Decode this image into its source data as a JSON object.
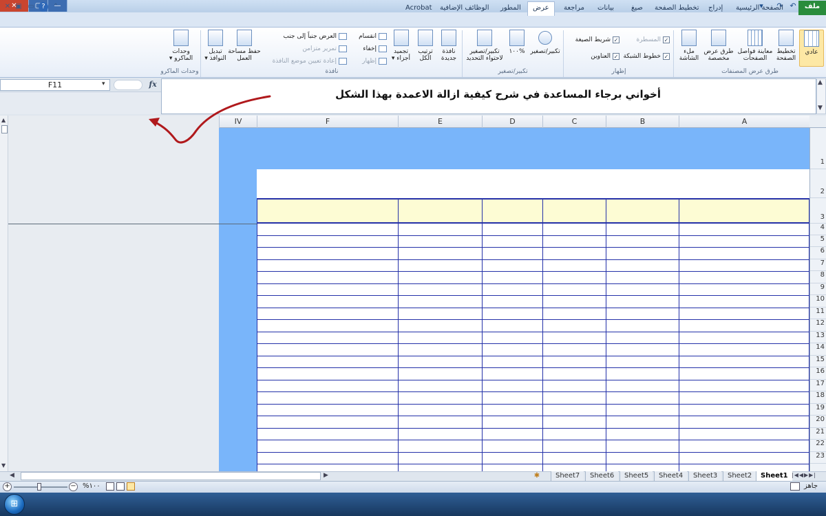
{
  "window": {
    "close": "✕",
    "restore": "▢",
    "minimize": "—",
    "qat_icons": [
      "excel-logo",
      "save-icon",
      "undo-icon",
      "redo-icon",
      "customize-icon"
    ]
  },
  "tabs": [
    {
      "label": "ملف",
      "active": false,
      "file": true
    },
    {
      "label": "الصفحة الرئيسية",
      "active": false
    },
    {
      "label": "إدراج",
      "active": false
    },
    {
      "label": "تخطيط الصفحة",
      "active": false
    },
    {
      "label": "صيغ",
      "active": false
    },
    {
      "label": "بيانات",
      "active": false
    },
    {
      "label": "مراجعة",
      "active": false
    },
    {
      "label": "عرض",
      "active": true
    },
    {
      "label": "المطور",
      "active": false
    },
    {
      "label": "الوظائف الإضافية",
      "active": false
    },
    {
      "label": "Acrobat",
      "active": false
    }
  ],
  "ribbon": {
    "workbook_views": {
      "label": "طرق عرض المصنفات",
      "buttons": [
        "عادي",
        "تخطيط\nالصفحة",
        "معاينة فواصل\nالصفحات",
        "طرق عرض\nمخصصة",
        "ملء\nالشاشة"
      ]
    },
    "show": {
      "label": "إظهار",
      "checks": [
        {
          "label": "المسطرة",
          "checked": true,
          "dim": true
        },
        {
          "label": "شريط الصيغة",
          "checked": true,
          "dim": false
        },
        {
          "label": "خطوط الشبكة",
          "checked": true,
          "dim": false
        },
        {
          "label": "العناوين",
          "checked": true,
          "dim": false
        }
      ]
    },
    "zoom": {
      "label": "تكبير/تصغير",
      "buttons": [
        "تكبير/تصغير",
        "%١٠٠",
        "تكبير/تصغير\nلاحتواء التحديد"
      ]
    },
    "window": {
      "label": "نافذة",
      "buttons": [
        "نافذة\nجديدة",
        "ترتيب\nالكل",
        "تجميد\nأجزاء ▾"
      ],
      "small": [
        {
          "label": "انقسام",
          "dim": false
        },
        {
          "label": "إخفاء",
          "dim": false
        },
        {
          "label": "إظهار",
          "dim": true
        },
        {
          "label": "العرض جنباً إلى جنب",
          "dim": false
        },
        {
          "label": "تمرير متزامن",
          "dim": true
        },
        {
          "label": "إعادة تعيين موضع النافذة",
          "dim": true
        }
      ],
      "buttons2": [
        "حفظ مساحة\nالعمل",
        "تبديل\nالنوافذ ▾"
      ]
    },
    "macros": {
      "label": "وحدات الماكرو",
      "button": "وحدات\nالماكرو ▾"
    }
  },
  "formula_bar": {
    "name_box": "F11",
    "fx": "fx",
    "content": "أخواني برجاء المساعدة في شرح كيفية ازالة الاعمدة بهذا الشكل"
  },
  "columns": [
    "IV",
    "F",
    "E",
    "D",
    "C",
    "B",
    "A"
  ],
  "rows": [
    "1",
    "2",
    "3",
    "4",
    "5",
    "6",
    "7",
    "8",
    "9",
    "10",
    "11",
    "12",
    "13",
    "14",
    "15",
    "16",
    "17",
    "18",
    "19",
    "20",
    "21",
    "22",
    "23"
  ],
  "sheets": [
    "Sheet7",
    "Sheet6",
    "Sheet5",
    "Sheet4",
    "Sheet3",
    "Sheet2",
    "Sheet1"
  ],
  "active_sheet": "Sheet1",
  "status": {
    "ready": "جاهز",
    "zoom": "%١٠٠"
  },
  "colors": {
    "accent": "#79b5fa",
    "table_line": "#2330a8",
    "header_fill": "#fdfcd4",
    "annotation_arrow": "#b0191c"
  }
}
